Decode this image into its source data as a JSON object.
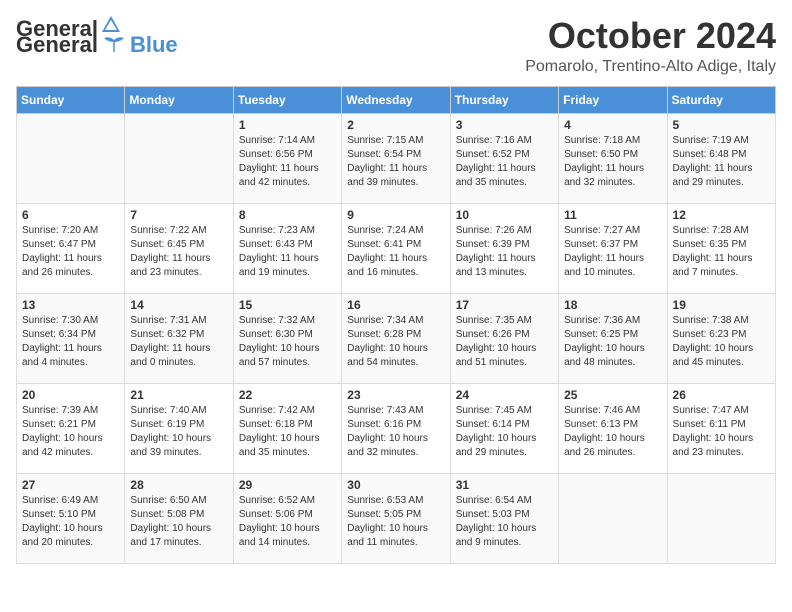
{
  "logo": {
    "general": "General",
    "blue": "Blue"
  },
  "title": {
    "month_year": "October 2024",
    "location": "Pomarolo, Trentino-Alto Adige, Italy"
  },
  "calendar": {
    "headers": [
      "Sunday",
      "Monday",
      "Tuesday",
      "Wednesday",
      "Thursday",
      "Friday",
      "Saturday"
    ],
    "weeks": [
      [
        {
          "day": "",
          "info": ""
        },
        {
          "day": "",
          "info": ""
        },
        {
          "day": "1",
          "info": "Sunrise: 7:14 AM\nSunset: 6:56 PM\nDaylight: 11 hours and 42 minutes."
        },
        {
          "day": "2",
          "info": "Sunrise: 7:15 AM\nSunset: 6:54 PM\nDaylight: 11 hours and 39 minutes."
        },
        {
          "day": "3",
          "info": "Sunrise: 7:16 AM\nSunset: 6:52 PM\nDaylight: 11 hours and 35 minutes."
        },
        {
          "day": "4",
          "info": "Sunrise: 7:18 AM\nSunset: 6:50 PM\nDaylight: 11 hours and 32 minutes."
        },
        {
          "day": "5",
          "info": "Sunrise: 7:19 AM\nSunset: 6:48 PM\nDaylight: 11 hours and 29 minutes."
        }
      ],
      [
        {
          "day": "6",
          "info": "Sunrise: 7:20 AM\nSunset: 6:47 PM\nDaylight: 11 hours and 26 minutes."
        },
        {
          "day": "7",
          "info": "Sunrise: 7:22 AM\nSunset: 6:45 PM\nDaylight: 11 hours and 23 minutes."
        },
        {
          "day": "8",
          "info": "Sunrise: 7:23 AM\nSunset: 6:43 PM\nDaylight: 11 hours and 19 minutes."
        },
        {
          "day": "9",
          "info": "Sunrise: 7:24 AM\nSunset: 6:41 PM\nDaylight: 11 hours and 16 minutes."
        },
        {
          "day": "10",
          "info": "Sunrise: 7:26 AM\nSunset: 6:39 PM\nDaylight: 11 hours and 13 minutes."
        },
        {
          "day": "11",
          "info": "Sunrise: 7:27 AM\nSunset: 6:37 PM\nDaylight: 11 hours and 10 minutes."
        },
        {
          "day": "12",
          "info": "Sunrise: 7:28 AM\nSunset: 6:35 PM\nDaylight: 11 hours and 7 minutes."
        }
      ],
      [
        {
          "day": "13",
          "info": "Sunrise: 7:30 AM\nSunset: 6:34 PM\nDaylight: 11 hours and 4 minutes."
        },
        {
          "day": "14",
          "info": "Sunrise: 7:31 AM\nSunset: 6:32 PM\nDaylight: 11 hours and 0 minutes."
        },
        {
          "day": "15",
          "info": "Sunrise: 7:32 AM\nSunset: 6:30 PM\nDaylight: 10 hours and 57 minutes."
        },
        {
          "day": "16",
          "info": "Sunrise: 7:34 AM\nSunset: 6:28 PM\nDaylight: 10 hours and 54 minutes."
        },
        {
          "day": "17",
          "info": "Sunrise: 7:35 AM\nSunset: 6:26 PM\nDaylight: 10 hours and 51 minutes."
        },
        {
          "day": "18",
          "info": "Sunrise: 7:36 AM\nSunset: 6:25 PM\nDaylight: 10 hours and 48 minutes."
        },
        {
          "day": "19",
          "info": "Sunrise: 7:38 AM\nSunset: 6:23 PM\nDaylight: 10 hours and 45 minutes."
        }
      ],
      [
        {
          "day": "20",
          "info": "Sunrise: 7:39 AM\nSunset: 6:21 PM\nDaylight: 10 hours and 42 minutes."
        },
        {
          "day": "21",
          "info": "Sunrise: 7:40 AM\nSunset: 6:19 PM\nDaylight: 10 hours and 39 minutes."
        },
        {
          "day": "22",
          "info": "Sunrise: 7:42 AM\nSunset: 6:18 PM\nDaylight: 10 hours and 35 minutes."
        },
        {
          "day": "23",
          "info": "Sunrise: 7:43 AM\nSunset: 6:16 PM\nDaylight: 10 hours and 32 minutes."
        },
        {
          "day": "24",
          "info": "Sunrise: 7:45 AM\nSunset: 6:14 PM\nDaylight: 10 hours and 29 minutes."
        },
        {
          "day": "25",
          "info": "Sunrise: 7:46 AM\nSunset: 6:13 PM\nDaylight: 10 hours and 26 minutes."
        },
        {
          "day": "26",
          "info": "Sunrise: 7:47 AM\nSunset: 6:11 PM\nDaylight: 10 hours and 23 minutes."
        }
      ],
      [
        {
          "day": "27",
          "info": "Sunrise: 6:49 AM\nSunset: 5:10 PM\nDaylight: 10 hours and 20 minutes."
        },
        {
          "day": "28",
          "info": "Sunrise: 6:50 AM\nSunset: 5:08 PM\nDaylight: 10 hours and 17 minutes."
        },
        {
          "day": "29",
          "info": "Sunrise: 6:52 AM\nSunset: 5:06 PM\nDaylight: 10 hours and 14 minutes."
        },
        {
          "day": "30",
          "info": "Sunrise: 6:53 AM\nSunset: 5:05 PM\nDaylight: 10 hours and 11 minutes."
        },
        {
          "day": "31",
          "info": "Sunrise: 6:54 AM\nSunset: 5:03 PM\nDaylight: 10 hours and 9 minutes."
        },
        {
          "day": "",
          "info": ""
        },
        {
          "day": "",
          "info": ""
        }
      ]
    ]
  }
}
